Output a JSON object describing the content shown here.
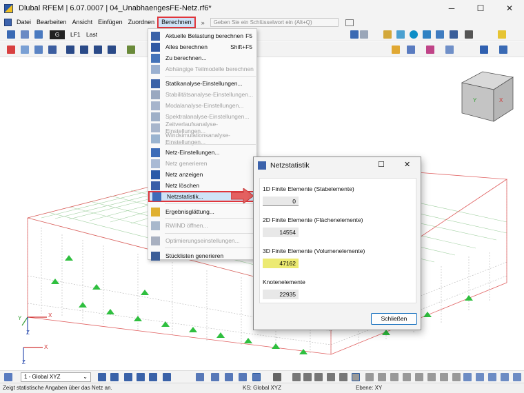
{
  "window": {
    "title": "Dlubal RFEM | 6.07.0007 | 04_UnabhaengesFE-Netz.rf6*",
    "minimize": "─",
    "maximize": "☐",
    "close": "✕"
  },
  "menubar": {
    "items": [
      "Datei",
      "Bearbeiten",
      "Ansicht",
      "Einfügen",
      "Zuordnen",
      "Berechnen"
    ],
    "overflow": "»",
    "search_placeholder": "Geben Sie ein Schlüsselwort ein (Alt+Q)"
  },
  "toolbar": {
    "load_case_type": "G",
    "load_case_id": "LF1",
    "load_case_name": "Last"
  },
  "berechnen_menu": {
    "items": [
      {
        "label": "Aktuelle Belastung berechnen",
        "shortcut": "F5",
        "enabled": true
      },
      {
        "label": "Alles berechnen",
        "shortcut": "Shift+F5",
        "enabled": true
      },
      {
        "label": "Zu berechnen...",
        "shortcut": "",
        "enabled": true
      },
      {
        "label": "Abhängige Teilmodelle berechnen",
        "shortcut": "",
        "enabled": false
      },
      {
        "label": "Statikanalyse-Einstellungen...",
        "shortcut": "",
        "enabled": true
      },
      {
        "label": "Stabilitätsanalyse-Einstellungen...",
        "shortcut": "",
        "enabled": false
      },
      {
        "label": "Modalanalyse-Einstellungen...",
        "shortcut": "",
        "enabled": false
      },
      {
        "label": "Spektralanalyse-Einstellungen...",
        "shortcut": "",
        "enabled": false
      },
      {
        "label": "Zeitverlaufsanalyse-Einstellungen...",
        "shortcut": "",
        "enabled": false
      },
      {
        "label": "Windsimulationsanalyse-Einstellungen...",
        "shortcut": "",
        "enabled": false
      },
      {
        "label": "Netz-Einstellungen...",
        "shortcut": "",
        "enabled": true
      },
      {
        "label": "Netz generieren",
        "shortcut": "",
        "enabled": false
      },
      {
        "label": "Netz anzeigen",
        "shortcut": "",
        "enabled": true
      },
      {
        "label": "Netz löschen",
        "shortcut": "",
        "enabled": true
      },
      {
        "label": "Netzstatistik...",
        "shortcut": "",
        "enabled": true,
        "highlighted": true
      },
      {
        "label": "Ergebnisglättung...",
        "shortcut": "",
        "enabled": true
      },
      {
        "label": "RWIND öffnen...",
        "shortcut": "",
        "enabled": false
      },
      {
        "label": "Optimierungseinstellungen...",
        "shortcut": "",
        "enabled": false
      },
      {
        "label": "Stücklisten generieren",
        "shortcut": "",
        "enabled": true
      }
    ]
  },
  "dialog": {
    "title": "Netzstatistik",
    "stats": [
      {
        "label": "1D Finite Elemente (Stabelemente)",
        "value": "0",
        "highlight": false
      },
      {
        "label": "2D Finite Elemente (Flächenelemente)",
        "value": "14554",
        "highlight": false
      },
      {
        "label": "3D Finite Elemente (Volumenelemente)",
        "value": "47162",
        "highlight": true
      },
      {
        "label": "Knotenelemente",
        "value": "22935",
        "highlight": false
      }
    ],
    "close_label": "Schließen"
  },
  "bottom_toolbar": {
    "coordinate_system": "1 - Global XYZ"
  },
  "statusbar": {
    "message": "Zeigt statistische Angaben über das Netz an.",
    "coordinate_system": "KS: Global XYZ",
    "plane": "Ebene: XY"
  },
  "axes": {
    "x": "X",
    "y": "Y",
    "z": "Z"
  },
  "colors": {
    "accent_red": "#e0353b",
    "highlight_blue": "#cfe4f7",
    "highlight_yellow": "#ecea72",
    "mesh_green": "#7ab87a",
    "support_green": "#2fbf3f"
  }
}
